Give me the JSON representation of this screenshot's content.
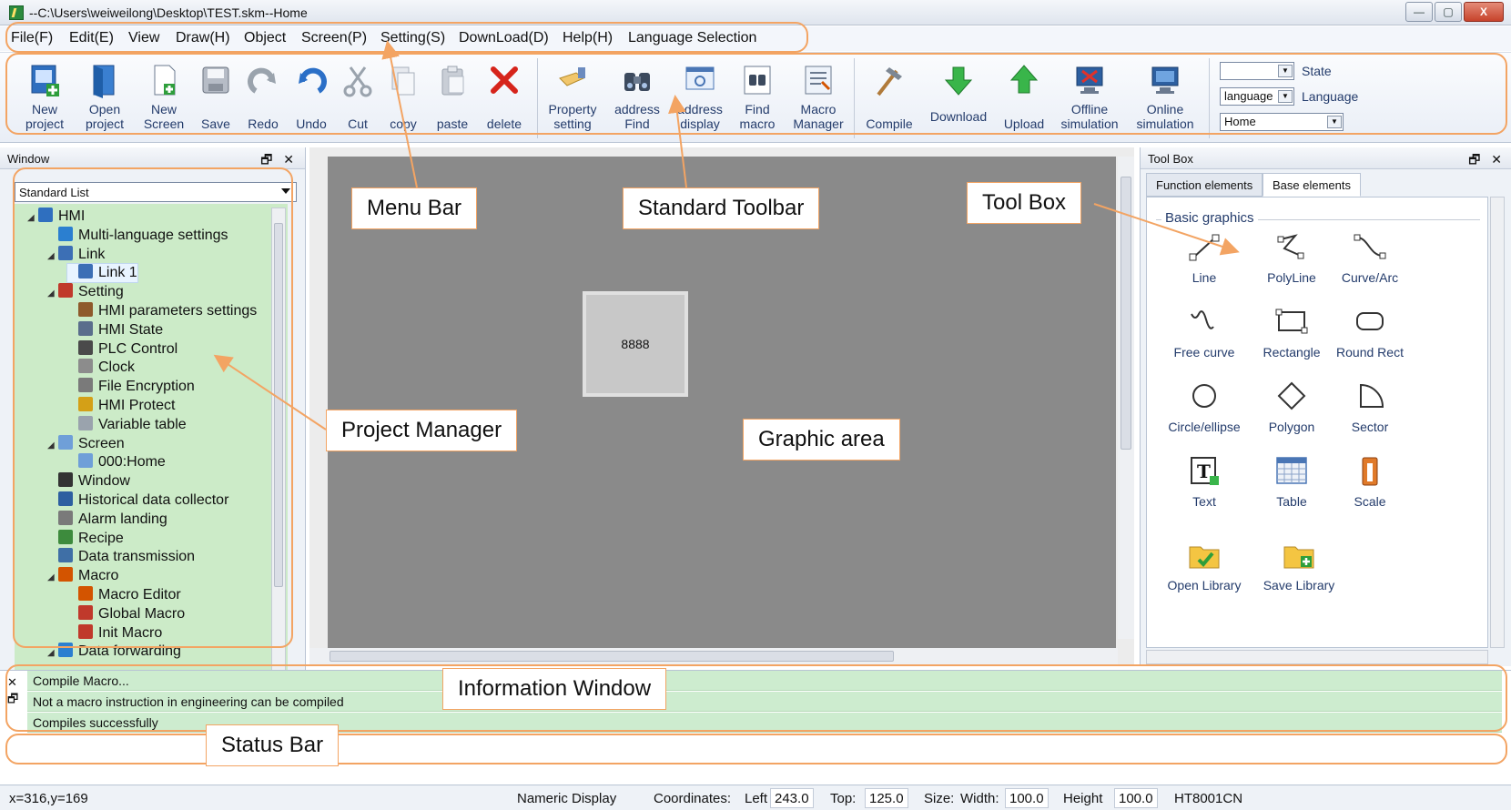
{
  "window": {
    "title": "--C:\\Users\\weiweilong\\Desktop\\TEST.skm--Home",
    "buttons": {
      "minimize": "—",
      "maximize": "▢",
      "close": "X"
    }
  },
  "menubar": {
    "items": [
      "File(F)",
      "Edit(E)",
      "View",
      "Draw(H)",
      "Object",
      "Screen(P)",
      "Setting(S)",
      "DownLoad(D)",
      "Help(H)",
      "Language Selection"
    ]
  },
  "toolbar": {
    "buttons": [
      {
        "label1": "New",
        "label2": "project",
        "icon": "new-project-icon"
      },
      {
        "label1": "Open",
        "label2": "project",
        "icon": "open-project-icon"
      },
      {
        "label1": "New",
        "label2": "Screen",
        "icon": "new-screen-icon"
      },
      {
        "label1": "",
        "label2": "Save",
        "icon": "save-icon"
      },
      {
        "label1": "",
        "label2": "Redo",
        "icon": "redo-icon"
      },
      {
        "label1": "",
        "label2": "Undo",
        "icon": "undo-icon"
      },
      {
        "label1": "",
        "label2": "Cut",
        "icon": "cut-icon"
      },
      {
        "label1": "",
        "label2": "copy",
        "icon": "copy-icon"
      },
      {
        "label1": "",
        "label2": "paste",
        "icon": "paste-icon"
      },
      {
        "label1": "",
        "label2": "delete",
        "icon": "delete-icon"
      },
      {
        "label1": "Property",
        "label2": "setting",
        "icon": "property-setting-icon"
      },
      {
        "label1": "address",
        "label2": "Find",
        "icon": "address-find-icon"
      },
      {
        "label1": "address",
        "label2": "display",
        "icon": "address-display-icon"
      },
      {
        "label1": "Find",
        "label2": "macro",
        "icon": "find-macro-icon"
      },
      {
        "label1": "Macro",
        "label2": "Manager",
        "icon": "macro-manager-icon"
      },
      {
        "label1": "",
        "label2": "Compile",
        "icon": "compile-icon"
      },
      {
        "label1": "Download",
        "label2": "",
        "icon": "download-icon"
      },
      {
        "label1": "",
        "label2": "Upload",
        "icon": "upload-icon"
      },
      {
        "label1": "Offline",
        "label2": "simulation",
        "icon": "offline-simulation-icon"
      },
      {
        "label1": "Online",
        "label2": "simulation",
        "icon": "online-simulation-icon"
      }
    ],
    "state_label": "State",
    "state_value": "",
    "language_label": "Language",
    "language_value": "language",
    "screen_value": "Home"
  },
  "project_manager": {
    "panel_title": "Window",
    "pin_glyphs": "🗗 ✕",
    "list_mode": "Standard List",
    "tree": [
      {
        "label": "HMI",
        "icon": "hmi-icon",
        "toggle": "◢",
        "color": "#2f6fbf"
      },
      {
        "label": "Multi-language settings",
        "icon": "globe-icon",
        "toggle": "",
        "color": "#2b7fd0"
      },
      {
        "label": "Link",
        "icon": "link-icon",
        "toggle": "◢",
        "color": "#3c6fb5"
      },
      {
        "label": "Link 1",
        "icon": "link-item-icon",
        "toggle": "",
        "color": "#3c6fb5"
      },
      {
        "label": "Setting",
        "icon": "tools-icon",
        "toggle": "◢",
        "color": "#c0392b"
      },
      {
        "label": "HMI parameters settings",
        "icon": "parameters-icon",
        "toggle": "",
        "color": "#8e5a2b"
      },
      {
        "label": "HMI State",
        "icon": "state-icon",
        "toggle": "",
        "color": "#5a6e8c"
      },
      {
        "label": "PLC Control",
        "icon": "plc-icon",
        "toggle": "",
        "color": "#4a4a4a"
      },
      {
        "label": "Clock",
        "icon": "clock-icon",
        "toggle": "",
        "color": "#8c8c8c"
      },
      {
        "label": "File Encryption",
        "icon": "lock-icon",
        "toggle": "",
        "color": "#7a7a7a"
      },
      {
        "label": "HMI Protect",
        "icon": "key-icon",
        "toggle": "",
        "color": "#d4a017"
      },
      {
        "label": "Variable table",
        "icon": "variable-table-icon",
        "toggle": "",
        "color": "#9aa3ad"
      },
      {
        "label": "Screen",
        "icon": "screen-icon",
        "toggle": "◢",
        "color": "#6f9fd8"
      },
      {
        "label": "000:Home",
        "icon": "screen-page-icon",
        "toggle": "",
        "color": "#6f9fd8"
      },
      {
        "label": "Window",
        "icon": "window-icon",
        "toggle": "",
        "color": "#333333"
      },
      {
        "label": "Historical data collector",
        "icon": "collector-icon",
        "toggle": "",
        "color": "#2d5fa0"
      },
      {
        "label": "Alarm landing",
        "icon": "alarm-icon",
        "toggle": "",
        "color": "#7a7a7a"
      },
      {
        "label": "Recipe",
        "icon": "recipe-icon",
        "toggle": "",
        "color": "#3d8b3d"
      },
      {
        "label": "Data transmission",
        "icon": "transmission-icon",
        "toggle": "",
        "color": "#3f6fa6"
      },
      {
        "label": "Macro",
        "icon": "macro-icon",
        "toggle": "◢",
        "color": "#d35400"
      },
      {
        "label": "Macro Editor",
        "icon": "macro-editor-icon",
        "toggle": "",
        "color": "#d35400"
      },
      {
        "label": "Global Macro",
        "icon": "global-macro-icon",
        "toggle": "",
        "color": "#c0392b"
      },
      {
        "label": "Init Macro",
        "icon": "init-macro-icon",
        "toggle": "",
        "color": "#c0392b"
      },
      {
        "label": "Data forwarding",
        "icon": "forwarding-icon",
        "toggle": "◢",
        "color": "#2b7fd0"
      }
    ]
  },
  "graphic_area": {
    "numeric_display_value": "8888",
    "hscroll_marker": "III",
    "vscroll_marker": "≡"
  },
  "toolbox": {
    "panel_title": "Tool Box",
    "pin_glyphs": "🗗 ✕",
    "tabs": [
      "Function elements",
      "Base elements"
    ],
    "active_tab": 1,
    "group_title": "Basic graphics",
    "tools": [
      {
        "label": "Line",
        "icon": "line-icon"
      },
      {
        "label": "PolyLine",
        "icon": "polyline-icon"
      },
      {
        "label": "Curve/Arc",
        "icon": "curve-arc-icon"
      },
      {
        "label": "Free curve",
        "icon": "free-curve-icon"
      },
      {
        "label": "Rectangle",
        "icon": "rectangle-icon"
      },
      {
        "label": "Round Rect",
        "icon": "round-rect-icon"
      },
      {
        "label": "Circle/ellipse",
        "icon": "circle-ellipse-icon"
      },
      {
        "label": "Polygon",
        "icon": "polygon-icon"
      },
      {
        "label": "Sector",
        "icon": "sector-icon"
      },
      {
        "label": "Text",
        "icon": "text-icon"
      },
      {
        "label": "Table",
        "icon": "table-icon"
      },
      {
        "label": "Scale",
        "icon": "scale-icon"
      },
      {
        "label": "Open Library",
        "icon": "open-library-icon"
      },
      {
        "label": "Save Library",
        "icon": "save-library-icon"
      }
    ]
  },
  "info_window": {
    "side_icons": [
      "✕",
      "🗗"
    ],
    "lines": [
      "Compile Macro...",
      "Not a macro instruction in engineering can be compiled",
      "Compiles successfully"
    ]
  },
  "statusbar": {
    "cursor": "x=316,y=169",
    "object_type": "Nameric Display",
    "coords_label": "Coordinates:",
    "left_label": "Left",
    "left_value": "243.0",
    "top_label": "Top:",
    "top_value": "125.0",
    "size_label": "Size:",
    "width_label": "Width:",
    "width_value": "100.0",
    "height_label": "Height",
    "height_value": "100.0",
    "model": "HT8001CN"
  },
  "annotations": {
    "menu_bar": "Menu Bar",
    "standard_toolbar": "Standard Toolbar",
    "tool_box": "Tool Box",
    "project_manager": "Project Manager",
    "graphic_area": "Graphic area",
    "information_window": "Information Window",
    "status_bar": "Status Bar"
  },
  "colors": {
    "annotation": "#f3a463",
    "tree_bg": "#ccebc8",
    "info_bg": "#cdeccf",
    "canvas": "#8a8a8a"
  }
}
